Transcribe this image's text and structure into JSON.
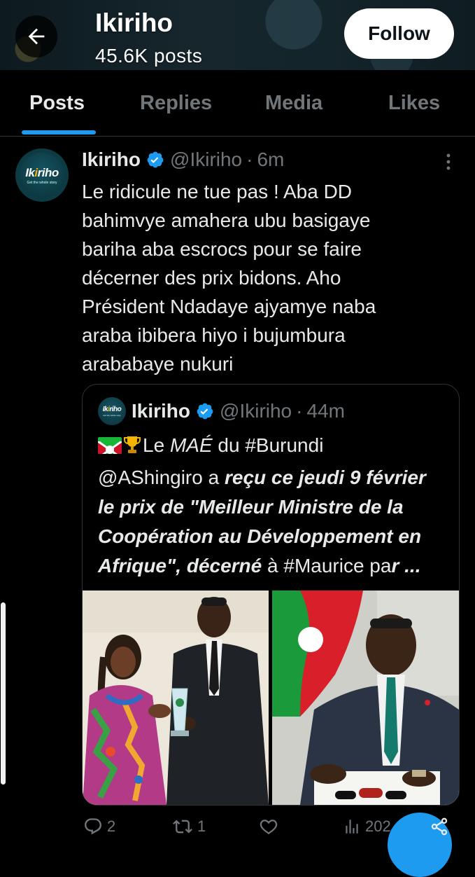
{
  "header": {
    "profile_name": "Ikiriho",
    "post_count": "45.6K posts",
    "follow_label": "Follow"
  },
  "tabs": [
    {
      "label": "Posts",
      "active": true
    },
    {
      "label": "Replies",
      "active": false
    },
    {
      "label": "Media",
      "active": false
    },
    {
      "label": "Likes",
      "active": false
    }
  ],
  "tweet": {
    "name": "Ikiriho",
    "handle": "@Ikiriho",
    "separator": "·",
    "time": "6m",
    "avatar_logo": "Ikiriho",
    "avatar_tagline": "Get the whole story",
    "text_lines": [
      "Le ridicule ne tue pas ! Aba DD",
      "bahimvye amahera ubu basigaye",
      "bariha aba escrocs pour se faire",
      "décerner des prix bidons. Aho",
      "Président Ndadaye ajyamye naba",
      "araba ibibera hiyo i bujumbura",
      "arababaye nukuri"
    ],
    "quote": {
      "name": "Ikiriho",
      "handle": "@Ikiriho",
      "separator": "·",
      "time": "44m",
      "line1_le": "Le ",
      "line1_mae": "MAÉ",
      "line1_rest": " du #Burundi",
      "line2_plain": "@AShingiro a ",
      "line2_bold": "reçu ce jeudi 9 février",
      "line3": "le prix de \"Meilleur Ministre de la",
      "line4": "Coopération au Développement en",
      "line5_bold": "Afrique\", décerné",
      "line5_plain": " à #Maurice pa",
      "line5_end": "r ..."
    }
  },
  "actions": {
    "replies": "2",
    "reposts": "1",
    "views": "202"
  },
  "colors": {
    "accent": "#1d9bf0",
    "background": "#000000",
    "text": "#e7e9ea",
    "muted": "#71767b",
    "border": "#2f3336"
  },
  "icons": [
    "back-arrow-icon",
    "verified-badge-icon",
    "more-dots-icon",
    "flag-burundi-icon",
    "trophy-icon",
    "reply-icon",
    "repost-icon",
    "like-icon",
    "views-icon",
    "share-icon"
  ]
}
